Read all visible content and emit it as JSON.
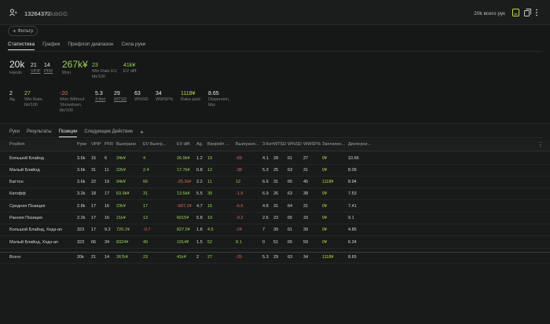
{
  "header": {
    "player_id": "13264372",
    "room": "ClubGG",
    "summary": "20k всего рук"
  },
  "filter": {
    "label": "Фильтр"
  },
  "tabs": [
    "Статистика",
    "График",
    "Префлоп диапазон",
    "Сила руки"
  ],
  "stats_row1": [
    {
      "value": "20k",
      "label": "Hands"
    },
    {
      "value": "21",
      "label": "VPIP"
    },
    {
      "value": "14",
      "label": "PFR"
    },
    {
      "value": "267k¥",
      "label": "Won"
    },
    {
      "value": "23",
      "label": "Win Rate EV, bb/100"
    },
    {
      "value": "41k¥",
      "label": "EV diff."
    }
  ],
  "stats_row2": [
    {
      "value": "2",
      "label": "Ag."
    },
    {
      "value": "27",
      "label": "Win Rate, bb/100"
    },
    {
      "value": "-20",
      "label": "Won Without Showdown, bb/100"
    },
    {
      "value": "5.3",
      "label": "3-Bet"
    },
    {
      "value": "29",
      "label": "WTSD"
    },
    {
      "value": "63",
      "label": "W%SD"
    },
    {
      "value": "34",
      "label": "WWSF%"
    },
    {
      "value": "1118¥",
      "label": "Rake paid"
    },
    {
      "value": "8.65",
      "label": "Dispersion, bbs"
    }
  ],
  "bottom_tabs": [
    "Руки",
    "Результаты",
    "Позиции",
    "Следующее Действие"
  ],
  "table": {
    "columns": [
      "Position",
      "Руки",
      "VPIP",
      "PFR",
      "Выиграно",
      "EV Выигр...",
      "EV diff.",
      "Ag.",
      "Винрейт ...",
      "Выиграно...",
      "3-Бет",
      "WTSD",
      "W%SD",
      "WWSF%",
      "Заплачен...",
      "Дисперси..."
    ],
    "rows": [
      [
        "Большой Блайнд",
        "3.6k",
        "15",
        "6",
        "34k¥",
        "4",
        "26.9k¥",
        "1.2",
        "19",
        "-69",
        "4.1",
        "28",
        "61",
        "27",
        "0¥",
        "10.66"
      ],
      [
        "Малый Блайнд",
        "3.6k",
        "31",
        "11",
        "22k¥",
        "2.4",
        "17.7k¥",
        "0.8",
        "12",
        "-38",
        "5.3",
        "25",
        "63",
        "31",
        "0¥",
        "8.09"
      ],
      [
        "Баттон",
        "3.6k",
        "22",
        "19",
        "94k¥",
        "66",
        "-25.2k¥",
        "2.2",
        "11",
        "12",
        "6.6",
        "31",
        "65",
        "45",
        "1118¥",
        "8.94"
      ],
      [
        "Катофф",
        "3.2k",
        "18",
        "17",
        "63.9k¥",
        "31",
        "13.5k¥",
        "5.5",
        "39",
        "-1.5",
        "6.9",
        "26",
        "63",
        "38",
        "0¥",
        "7.53"
      ],
      [
        "Средняя Позиция",
        "2.8k",
        "17",
        "16",
        "23k¥",
        "17",
        "-607.1¥",
        "4.7",
        "16",
        "-6.5",
        "4.8",
        "31",
        "64",
        "31",
        "0¥",
        "7.41"
      ],
      [
        "Ранняя Позиция",
        "2.2k",
        "17",
        "16",
        "21k¥",
        "13",
        "6015¥",
        "5.8",
        "19",
        "-9.2",
        "2.6",
        "23",
        "65",
        "33",
        "0¥",
        "9.1"
      ],
      [
        "Большой Блайнд, Хедз-ап",
        "323",
        "17",
        "9.2",
        "720.1¥",
        "-0.7",
        "827.5¥",
        "1.8",
        "4.5",
        "-24",
        "7",
        "39",
        "61",
        "39",
        "0¥",
        "4.85"
      ],
      [
        "Малый Блайнд, Хедз-ап",
        "323",
        "66",
        "34",
        "8324¥",
        "40",
        "1914¥",
        "1.5",
        "52",
        "8.1",
        "0",
        "51",
        "65",
        "59",
        "0¥",
        "6.24"
      ]
    ],
    "total": [
      "Всего",
      "20k",
      "21",
      "14",
      "267k¥",
      "23",
      "41k¥",
      "2",
      "27",
      "-20",
      "5.3",
      "29",
      "63",
      "34",
      "1118¥",
      "8.65"
    ],
    "cell_colors": [
      [
        "w",
        "w",
        "w",
        "w",
        "g",
        "g",
        "g",
        "w",
        "g",
        "r",
        "w",
        "w",
        "w",
        "w",
        "y",
        "w"
      ],
      [
        "w",
        "w",
        "w",
        "w",
        "g",
        "g",
        "g",
        "w",
        "g",
        "r",
        "w",
        "w",
        "w",
        "w",
        "y",
        "w"
      ],
      [
        "w",
        "w",
        "w",
        "w",
        "g",
        "g",
        "r",
        "w",
        "g",
        "g",
        "w",
        "w",
        "w",
        "w",
        "y",
        "w"
      ],
      [
        "w",
        "w",
        "w",
        "w",
        "g",
        "g",
        "g",
        "w",
        "g",
        "r",
        "w",
        "w",
        "w",
        "w",
        "y",
        "w"
      ],
      [
        "w",
        "w",
        "w",
        "w",
        "g",
        "g",
        "r",
        "w",
        "g",
        "r",
        "w",
        "w",
        "w",
        "w",
        "y",
        "w"
      ],
      [
        "w",
        "w",
        "w",
        "w",
        "g",
        "g",
        "g",
        "w",
        "g",
        "r",
        "w",
        "w",
        "w",
        "w",
        "y",
        "w"
      ],
      [
        "w",
        "w",
        "w",
        "w",
        "g",
        "r",
        "g",
        "w",
        "g",
        "r",
        "w",
        "w",
        "w",
        "w",
        "y",
        "w"
      ],
      [
        "w",
        "w",
        "w",
        "w",
        "g",
        "g",
        "g",
        "w",
        "g",
        "g",
        "w",
        "w",
        "w",
        "w",
        "y",
        "w"
      ]
    ],
    "total_colors": [
      "w",
      "w",
      "w",
      "w",
      "g",
      "g",
      "g",
      "w",
      "g",
      "r",
      "w",
      "w",
      "w",
      "w",
      "y",
      "w"
    ]
  }
}
